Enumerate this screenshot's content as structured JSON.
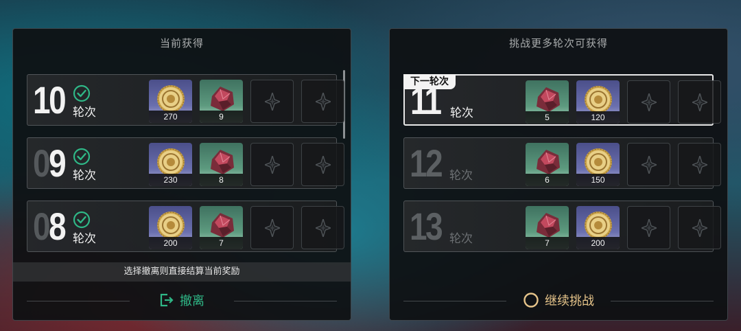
{
  "left_panel": {
    "title": "当前获得",
    "hint": "选择撤离则直接结算当前奖励",
    "action_label": "撤离",
    "rounds": [
      {
        "num_prefix": "",
        "num": "10",
        "label": "轮次",
        "completed": true,
        "rewards": [
          {
            "type": "coin",
            "count": "270"
          },
          {
            "type": "gem",
            "count": "9"
          }
        ]
      },
      {
        "num_prefix": "0",
        "num": "9",
        "label": "轮次",
        "completed": true,
        "rewards": [
          {
            "type": "coin",
            "count": "230"
          },
          {
            "type": "gem",
            "count": "8"
          }
        ]
      },
      {
        "num_prefix": "0",
        "num": "8",
        "label": "轮次",
        "completed": true,
        "rewards": [
          {
            "type": "coin",
            "count": "200"
          },
          {
            "type": "gem",
            "count": "7"
          }
        ]
      }
    ]
  },
  "right_panel": {
    "title": "挑战更多轮次可获得",
    "action_label": "继续挑战",
    "next_tag": "下一轮次",
    "rounds": [
      {
        "num": "11",
        "label": "轮次",
        "next": true,
        "rewards": [
          {
            "type": "gem",
            "count": "5"
          },
          {
            "type": "coin",
            "count": "120"
          }
        ]
      },
      {
        "num": "12",
        "label": "轮次",
        "next": false,
        "rewards": [
          {
            "type": "gem",
            "count": "6"
          },
          {
            "type": "coin",
            "count": "150"
          }
        ]
      },
      {
        "num": "13",
        "label": "轮次",
        "next": false,
        "rewards": [
          {
            "type": "gem",
            "count": "7"
          },
          {
            "type": "coin",
            "count": "200"
          }
        ]
      }
    ]
  },
  "colors": {
    "retreat": "#2fb887",
    "continue": "#e6c48a",
    "check": "#2fb887"
  },
  "icons": {
    "coin": "gold-coin-icon",
    "gem": "red-gem-icon",
    "empty": "diamond-star-icon",
    "check": "check-circle-icon",
    "exit": "exit-door-icon",
    "continue": "circle-icon"
  }
}
